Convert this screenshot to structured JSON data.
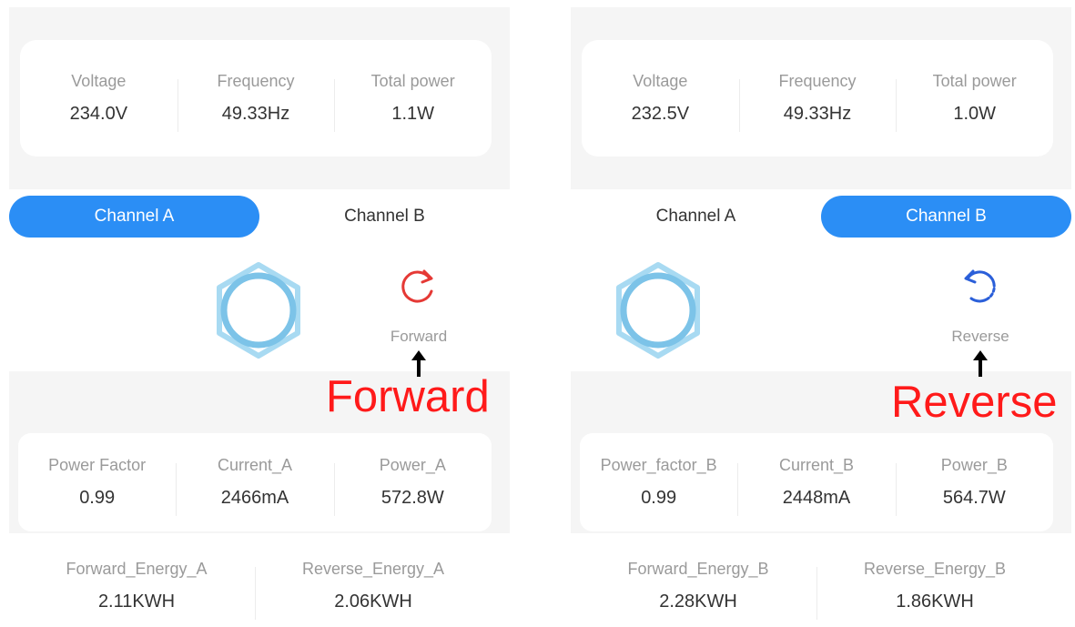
{
  "panels": [
    {
      "stats": [
        {
          "label": "Voltage",
          "value": "234.0V"
        },
        {
          "label": "Frequency",
          "value": "49.33Hz"
        },
        {
          "label": "Total power",
          "value": "1.1W"
        }
      ],
      "tabs": [
        "Channel A",
        "Channel B"
      ],
      "active_tab": 0,
      "direction_label": "Forward",
      "callout": "Forward",
      "metrics": [
        {
          "label": "Power Factor",
          "value": "0.99"
        },
        {
          "label": "Current_A",
          "value": "2466mA"
        },
        {
          "label": "Power_A",
          "value": "572.8W"
        }
      ],
      "energy": [
        {
          "label": "Forward_Energy_A",
          "value": "2.11KWH"
        },
        {
          "label": "Reverse_Energy_A",
          "value": "2.06KWH"
        }
      ]
    },
    {
      "stats": [
        {
          "label": "Voltage",
          "value": "232.5V"
        },
        {
          "label": "Frequency",
          "value": "49.33Hz"
        },
        {
          "label": "Total power",
          "value": "1.0W"
        }
      ],
      "tabs": [
        "Channel A",
        "Channel B"
      ],
      "active_tab": 1,
      "direction_label": "Reverse",
      "callout": "Reverse",
      "metrics": [
        {
          "label": "Power_factor_B",
          "value": "0.99"
        },
        {
          "label": "Current_B",
          "value": "2448mA"
        },
        {
          "label": "Power_B",
          "value": "564.7W"
        }
      ],
      "energy": [
        {
          "label": "Forward_Energy_B",
          "value": "2.28KWH"
        },
        {
          "label": "Reverse_Energy_B",
          "value": "1.86KWH"
        }
      ]
    }
  ],
  "colors": {
    "accent": "#2b8ef5",
    "forward_icon": "#e53935",
    "reverse_icon": "#2b5fd9",
    "callout": "#ff1a1a",
    "ring": "#7cc3e8"
  },
  "icons": {
    "ring": "hexagonal-ring-icon",
    "forward": "rotate-clockwise-icon",
    "reverse": "rotate-counterclockwise-icon",
    "arrow": "arrow-up-icon"
  }
}
